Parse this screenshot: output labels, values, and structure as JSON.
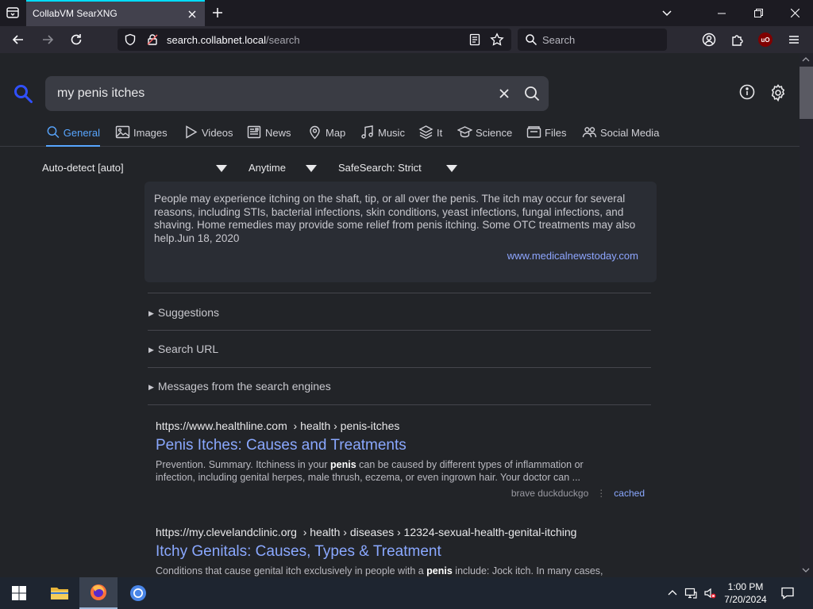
{
  "browser": {
    "tab_title": "CollabVM SearXNG",
    "url_host": "search.collabnet.local",
    "url_path": "/search",
    "search_placeholder": "Search",
    "ublock_badge": "uO"
  },
  "search": {
    "query": "my penis itches"
  },
  "categories": [
    {
      "label": "General",
      "icon": "search-icon",
      "active": true
    },
    {
      "label": "Images",
      "icon": "image-icon"
    },
    {
      "label": "Videos",
      "icon": "play-icon"
    },
    {
      "label": "News",
      "icon": "newspaper-icon"
    },
    {
      "label": "Map",
      "icon": "map-pin-icon"
    },
    {
      "label": "Music",
      "icon": "music-icon"
    },
    {
      "label": "It",
      "icon": "layers-icon"
    },
    {
      "label": "Science",
      "icon": "graduation-cap-icon"
    },
    {
      "label": "Files",
      "icon": "files-icon"
    },
    {
      "label": "Social Media",
      "icon": "people-icon"
    }
  ],
  "filters": {
    "language": "Auto-detect [auto]",
    "time": "Anytime",
    "safesearch": "SafeSearch: Strict"
  },
  "answer": {
    "text": "People may experience itching on the shaft, tip, or all over the penis. The itch may occur for several reasons, including STIs, bacterial infections, skin conditions, yeast infections, fungal infections, and shaving. Home remedies may provide some relief from penis itching. Some OTC treatments may also help.Jun 18, 2020",
    "source": "www.medicalnewstoday.com"
  },
  "details": {
    "suggestions": "Suggestions",
    "search_url": "Search URL",
    "messages": "Messages from the search engines"
  },
  "results": [
    {
      "url": "https://www.healthline.com",
      "path": "› health › penis-itches",
      "title": "Penis Itches: Causes and Treatments",
      "snippet_pre": "Prevention. Summary. Itchiness in your ",
      "snippet_bold": "penis",
      "snippet_post": " can be caused by different types of inflammation or infection, including genital herpes, male thrush, eczema, or even ingrown hair. Your doctor can ...",
      "engines": "brave  duckduckgo",
      "cached": "cached"
    },
    {
      "url": "https://my.clevelandclinic.org",
      "path": "› health › diseases › 12324-sexual-health-genital-itching",
      "title": "Itchy Genitals: Causes, Types & Treatment",
      "snippet_pre": "Conditions that cause genital itch exclusively in people with a ",
      "snippet_bold": "penis",
      "snippet_post": " include: Jock itch. In many cases,"
    }
  ],
  "taskbar": {
    "time": "1:00 PM",
    "date": "7/20/2024"
  },
  "colors": {
    "accent": "#58a6ff",
    "link": "#8aa8ff",
    "logo": "#3050ff"
  }
}
